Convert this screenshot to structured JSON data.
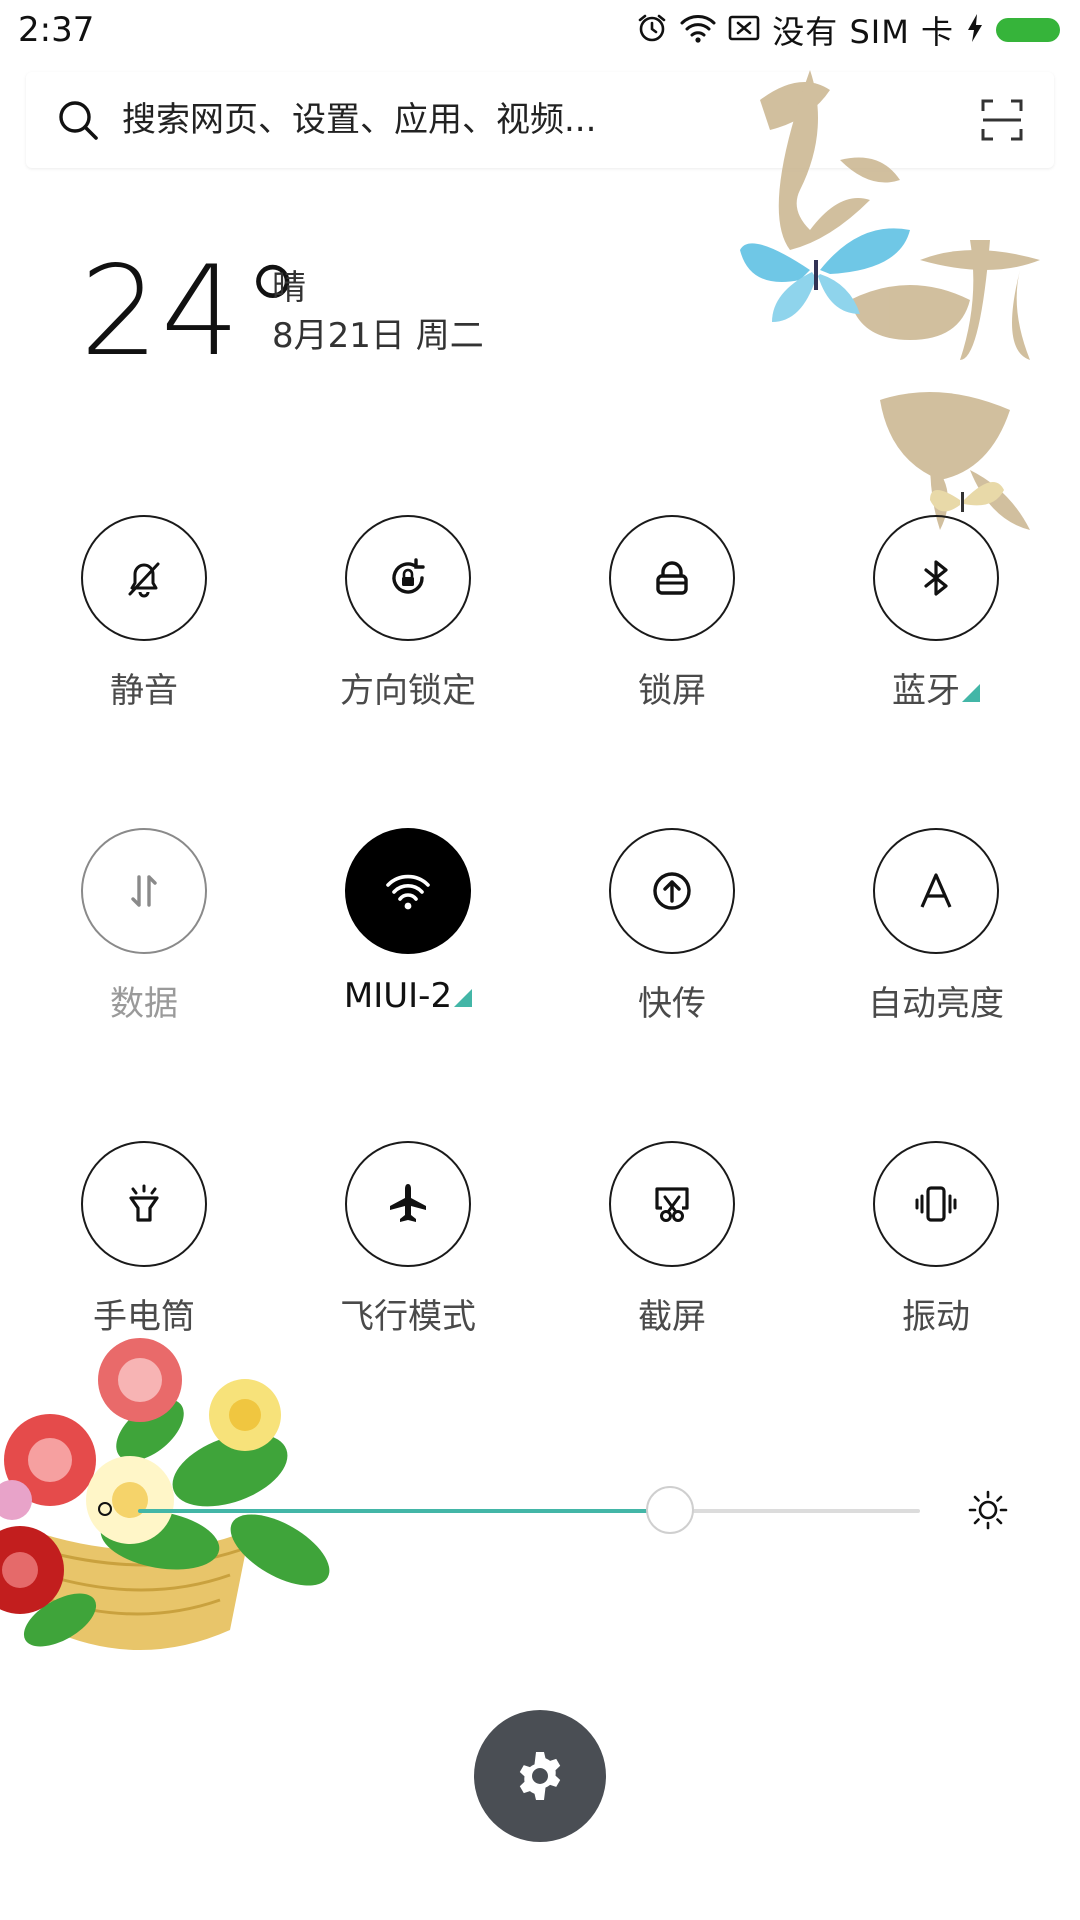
{
  "status_bar": {
    "time": "2:37",
    "sim_text": "没有 SIM 卡",
    "icons": [
      "alarm-icon",
      "wifi-icon",
      "no-sim-icon",
      "charging-bolt-icon",
      "battery-icon"
    ],
    "battery_color": "#36b43a"
  },
  "search": {
    "placeholder": "搜索网页、设置、应用、视频..."
  },
  "weather": {
    "temperature": "24°",
    "condition": "晴",
    "date": "8月21日 周二"
  },
  "decoration": {
    "calligraphy_text": "花开富贵"
  },
  "toggles": [
    {
      "label": "静音",
      "icon": "bell-off-icon",
      "state": "off"
    },
    {
      "label": "方向锁定",
      "icon": "rotation-lock-icon",
      "state": "off"
    },
    {
      "label": "锁屏",
      "icon": "lock-icon",
      "state": "off"
    },
    {
      "label": "蓝牙",
      "icon": "bluetooth-icon",
      "state": "off",
      "has_details": true
    },
    {
      "label": "数据",
      "icon": "mobile-data-icon",
      "state": "disabled"
    },
    {
      "label": "MIUI-2",
      "icon": "wifi-icon",
      "state": "on",
      "has_details": true
    },
    {
      "label": "快传",
      "icon": "quick-transfer-icon",
      "state": "off"
    },
    {
      "label": "自动亮度",
      "icon": "auto-brightness-icon",
      "state": "off"
    },
    {
      "label": "手电筒",
      "icon": "flashlight-icon",
      "state": "off"
    },
    {
      "label": "飞行模式",
      "icon": "airplane-icon",
      "state": "off"
    },
    {
      "label": "截屏",
      "icon": "screenshot-icon",
      "state": "off"
    },
    {
      "label": "振动",
      "icon": "vibrate-icon",
      "state": "off"
    }
  ],
  "brightness": {
    "level_fraction": 0.68,
    "accent_color": "#43b6a7"
  },
  "settings_button": {
    "icon": "gear-icon",
    "color": "#4a4e54"
  }
}
